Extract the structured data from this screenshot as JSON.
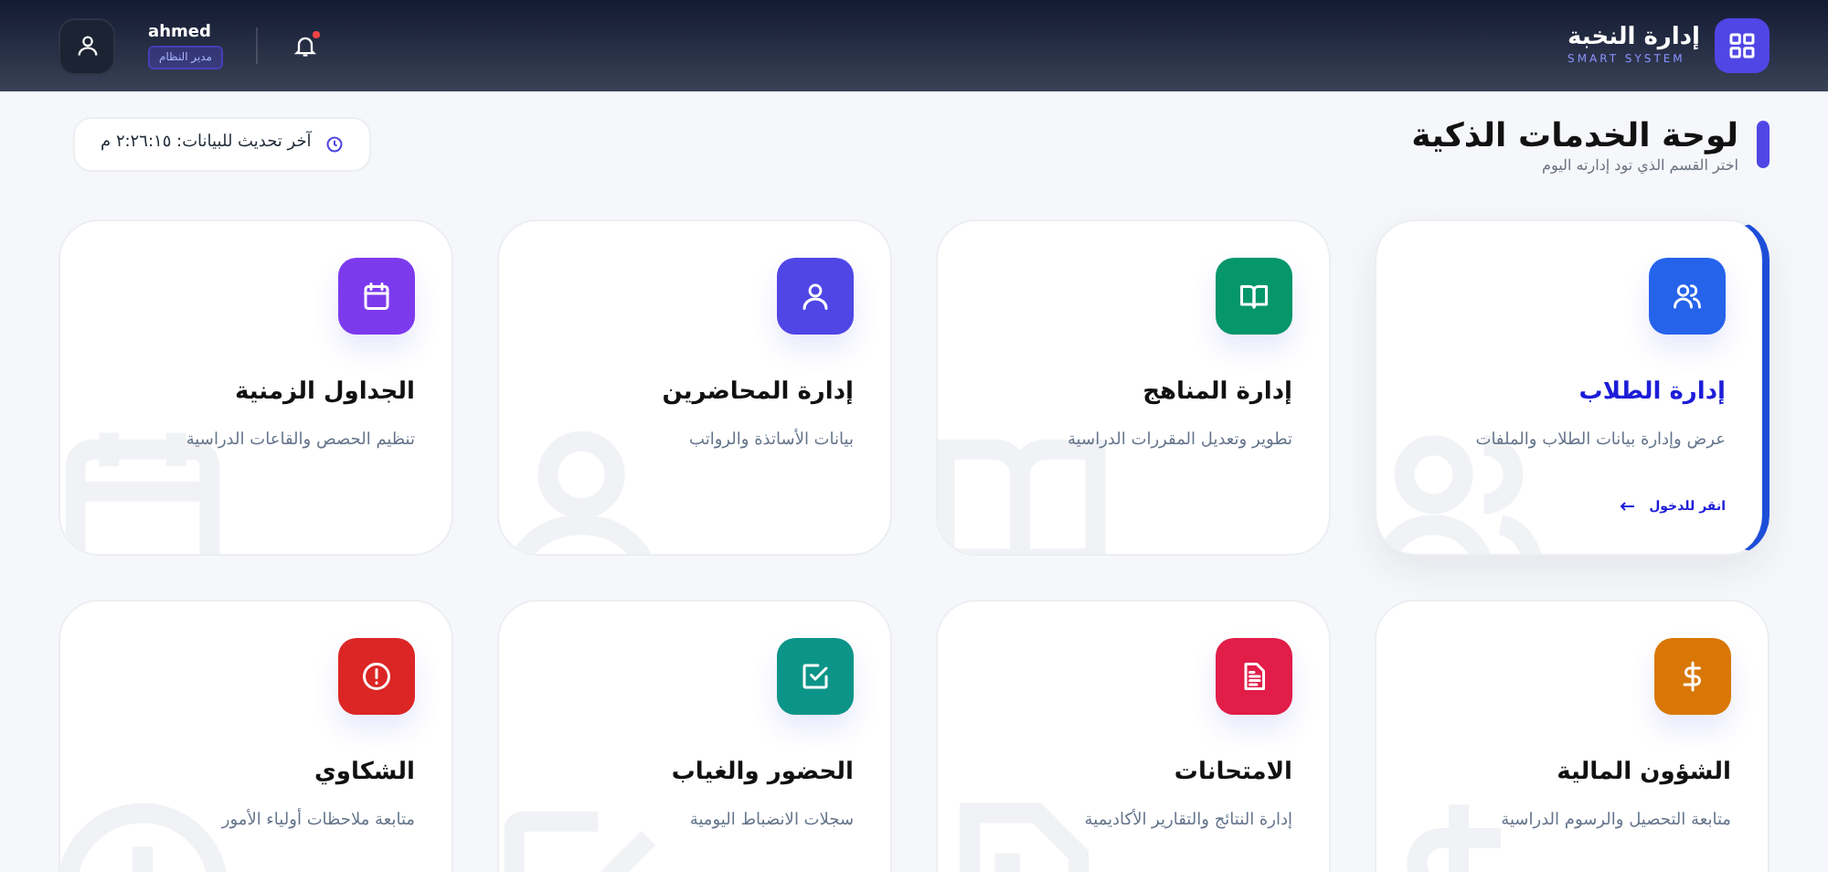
{
  "header": {
    "brand_title": "إدارة النخبة",
    "brand_subtitle": "SMART SYSTEM",
    "user_name": "ahmed",
    "user_role": "مدير النظام",
    "notifications_unread": true
  },
  "page": {
    "title": "لوحة الخدمات الذكية",
    "subtitle": "اختر القسم الذي تود إدارته اليوم",
    "last_update": "آخر تحديث للبيانات: ٢:٢٦:١٥ م"
  },
  "cards": [
    {
      "kind": "users",
      "color": "#2563eb",
      "title": "إدارة الطلاب",
      "description": "عرض وإدارة بيانات الطلاب والملفات",
      "selected": true,
      "action": "انقر للدخول"
    },
    {
      "kind": "book",
      "color": "#059669",
      "title": "إدارة المناهج",
      "description": "تطوير وتعديل المقررات الدراسية",
      "selected": false
    },
    {
      "kind": "user",
      "color": "#4f46e5",
      "title": "إدارة المحاضرين",
      "description": "بيانات الأساتذة والرواتب",
      "selected": false
    },
    {
      "kind": "calendar",
      "color": "#7c3aed",
      "title": "الجداول الزمنية",
      "description": "تنظيم الحصص والقاعات الدراسية",
      "selected": false
    },
    {
      "kind": "dollar",
      "color": "#d97706",
      "title": "الشؤون المالية",
      "description": "متابعة التحصيل والرسوم الدراسية",
      "selected": false
    },
    {
      "kind": "file",
      "color": "#e11d48",
      "title": "الامتحانات",
      "description": "إدارة النتائج والتقارير الأكاديمية",
      "selected": false
    },
    {
      "kind": "check",
      "color": "#0d9488",
      "title": "الحضور والغياب",
      "description": "سجلات الانضباط اليومية",
      "selected": false
    },
    {
      "kind": "alert",
      "color": "#dc2626",
      "title": "الشكاوي",
      "description": "متابعة ملاحظات أولياء الأمور",
      "selected": false
    }
  ]
}
